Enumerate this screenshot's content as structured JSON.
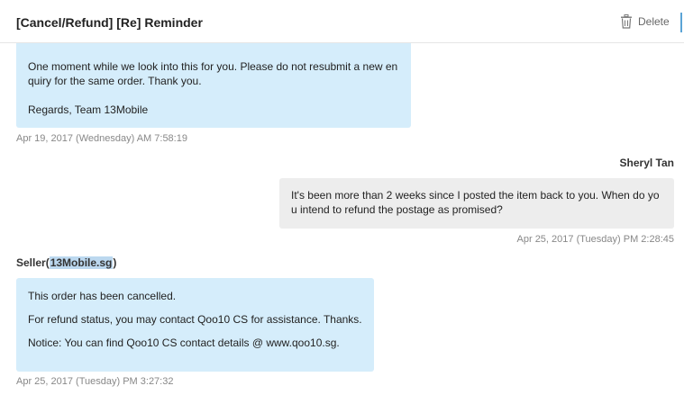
{
  "header": {
    "title": "[Cancel/Refund] [Re] Reminder",
    "delete_label": "Delete"
  },
  "messages": [
    {
      "from": "seller",
      "lines": [
        "One moment while we look into this for you. Please do not resubmit a new en",
        "quiry for the same order. Thank you.",
        "Regards, Team 13Mobile"
      ],
      "timestamp": "Apr 19, 2017 (Wednesday) AM 7:58:19"
    },
    {
      "from": "buyer",
      "sender": "Sheryl Tan",
      "lines": [
        "It's been more than 2 weeks since I posted the item back to you. When do yo",
        "u intend to refund the postage as promised?"
      ],
      "timestamp": "Apr 25, 2017 (Tuesday) PM 2:28:45"
    },
    {
      "from": "seller",
      "sender_prefix": "Seller(",
      "sender_name": "13Mobile.sg",
      "sender_suffix": ")",
      "lines": [
        "This order has been cancelled.",
        "For refund status, you may contact Qoo10 CS for assistance. Thanks.",
        "Notice: You can find Qoo10 CS contact details @ www.qoo10.sg."
      ],
      "timestamp": "Apr 25, 2017 (Tuesday) PM 3:27:32"
    }
  ],
  "colors": {
    "seller_bubble": "#d5edfb",
    "buyer_bubble": "#ededed",
    "highlight": "#bcd8ef"
  },
  "icons": {
    "delete": "trash-icon"
  }
}
